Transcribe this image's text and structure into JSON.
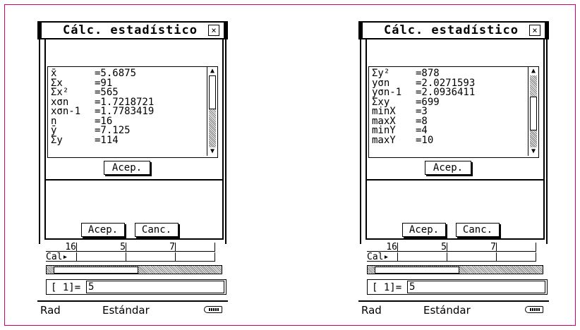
{
  "screens": [
    {
      "title": "Cálc. estadístico",
      "close_icon": "×",
      "stats": [
        {
          "name": "x̄",
          "value": "=5.6875"
        },
        {
          "name": "Σx",
          "value": "=91"
        },
        {
          "name": "Σx²",
          "value": "=565"
        },
        {
          "name": "xσn",
          "value": "=1.7218721"
        },
        {
          "name": "xσn-1",
          "value": "=1.7783419"
        },
        {
          "name": "n",
          "value": "=16"
        },
        {
          "name": "ȳ",
          "value": "=7.125"
        },
        {
          "name": "Σy",
          "value": "=114"
        }
      ],
      "scroll_fraction": 0.0,
      "accept_label": "Acep.",
      "accept2_label": "Acep.",
      "cancel_label": "Canc.",
      "sheet": {
        "c1": "16",
        "c2": "5",
        "c3": "7",
        "row2": "Cal▸"
      },
      "entry_label": "[     1]=",
      "entry_value": "5",
      "status": {
        "mode": "Rad",
        "format": "Estándar"
      }
    },
    {
      "title": "Cálc. estadístico",
      "close_icon": "×",
      "stats": [
        {
          "name": "Σy²",
          "value": "=878"
        },
        {
          "name": "yσn",
          "value": "=2.0271593"
        },
        {
          "name": "yσn-1",
          "value": "=2.0936411"
        },
        {
          "name": "Σxy",
          "value": "=699"
        },
        {
          "name": "minX",
          "value": "=3"
        },
        {
          "name": "maxX",
          "value": "=8"
        },
        {
          "name": "minY",
          "value": "=4"
        },
        {
          "name": "maxY",
          "value": "=10"
        }
      ],
      "scroll_fraction": 0.55,
      "accept_label": "Acep.",
      "accept2_label": "Acep.",
      "cancel_label": "Canc.",
      "sheet": {
        "c1": "16",
        "c2": "5",
        "c3": "7",
        "row2": "Cal▸"
      },
      "entry_label": "[     1]=",
      "entry_value": "5",
      "status": {
        "mode": "Rad",
        "format": "Estándar"
      }
    }
  ]
}
